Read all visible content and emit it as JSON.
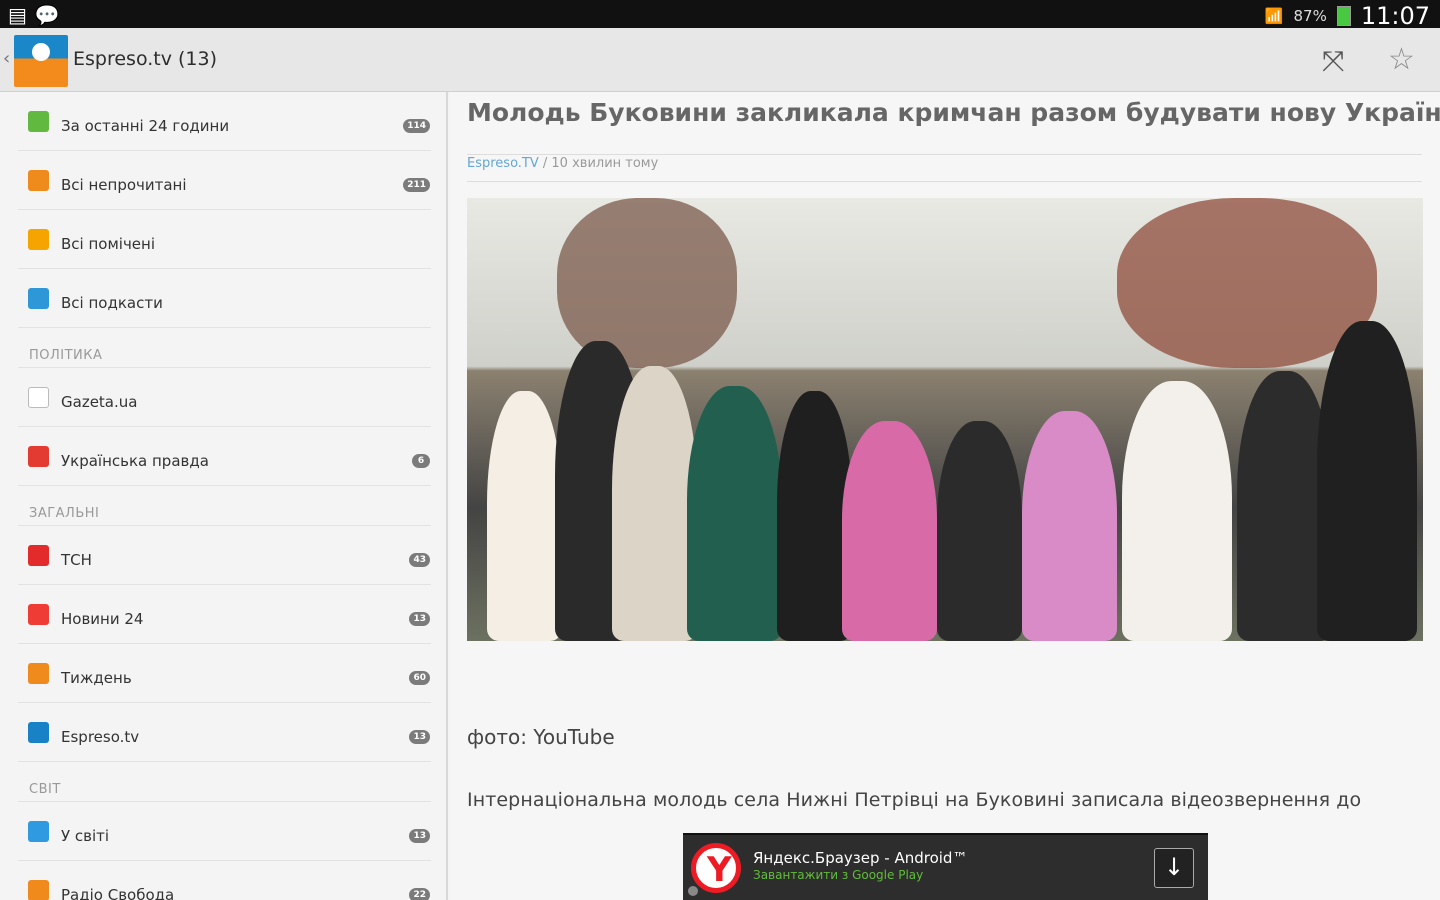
{
  "status": {
    "clock": "11:07",
    "battery": "87%"
  },
  "header": {
    "title": "Espreso.tv (13)"
  },
  "sidebar": [
    {
      "type": "item",
      "label": "За останні 24 години",
      "badge": "114",
      "icon": "rss-icon",
      "color": "#61b93f"
    },
    {
      "type": "item",
      "label": "Всі непрочитані",
      "badge": "211",
      "icon": "eye-icon",
      "color": "#ef8a1d"
    },
    {
      "type": "item",
      "label": "Всі помічені",
      "badge": "",
      "icon": "star-icon",
      "color": "#f5a400"
    },
    {
      "type": "item",
      "label": "Всі подкасти",
      "badge": "",
      "icon": "podcast-icon",
      "color": "#2d97d8"
    },
    {
      "type": "section",
      "label": "ПОЛІТИКА"
    },
    {
      "type": "item",
      "label": "Gazeta.ua",
      "badge": "",
      "icon": "gazeta-icon",
      "color": "#ffffff"
    },
    {
      "type": "item",
      "label": "Українська правда",
      "badge": "6",
      "icon": "up-logo-icon",
      "color": "#e33a32"
    },
    {
      "type": "section",
      "label": "ЗАГАЛЬНІ"
    },
    {
      "type": "item",
      "label": "ТСН",
      "badge": "43",
      "icon": "tsn-icon",
      "color": "#e42b2b"
    },
    {
      "type": "item",
      "label": "Новини 24",
      "badge": "13",
      "icon": "news24-icon",
      "color": "#ef3d36"
    },
    {
      "type": "item",
      "label": "Тиждень",
      "badge": "60",
      "icon": "rss-icon",
      "color": "#f18a1c"
    },
    {
      "type": "item",
      "label": "Espreso.tv",
      "badge": "13",
      "icon": "espreso-icon",
      "color": "#1982c7"
    },
    {
      "type": "section",
      "label": "СВІТ"
    },
    {
      "type": "item",
      "label": "У світі",
      "badge": "13",
      "icon": "world-icon",
      "color": "#2f9ae0"
    },
    {
      "type": "item",
      "label": "Радіо Свобода",
      "badge": "22",
      "icon": "radio-icon",
      "color": "#f18a1c"
    }
  ],
  "article": {
    "title": "Молодь Буковини закликала кримчан разом будувати нову Україну",
    "source": "Espreso.TV",
    "time": " / 10 хвилин тому",
    "caption": "фото: YouTube",
    "text": "Інтернаціональна молодь села Нижні Петрівці на Буковині записала відеозвернення до"
  },
  "ad": {
    "title": "Яндекс.Браузер - Android™",
    "subtitle": "Завантажити з Google Play"
  }
}
